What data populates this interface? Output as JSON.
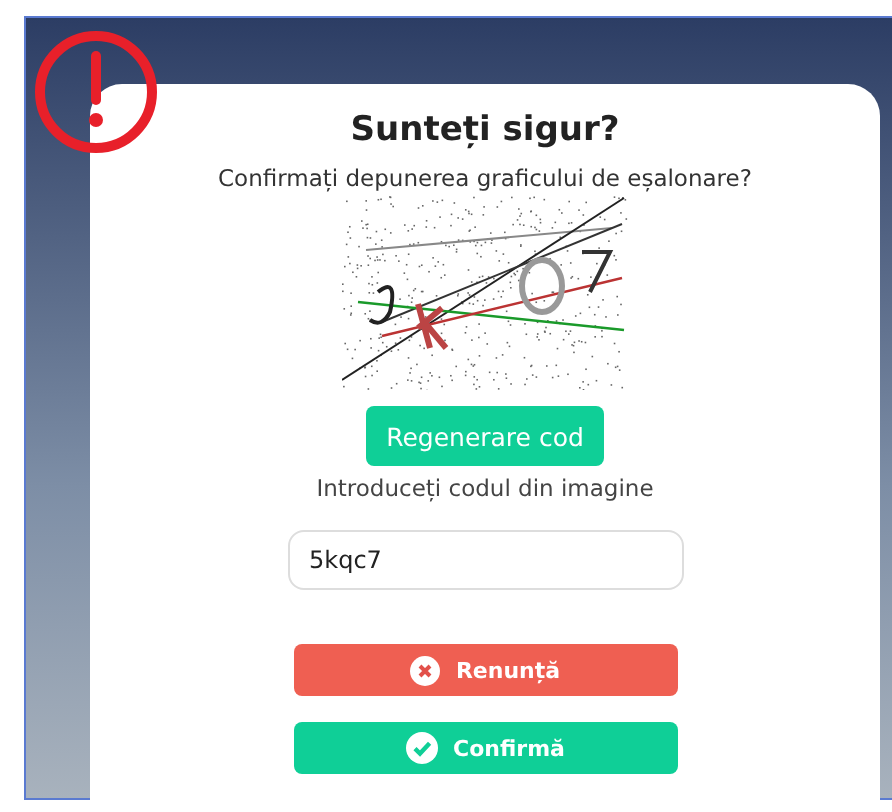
{
  "dialog": {
    "title": "Sunteți sigur?",
    "message": "Confirmați depunerea graficului de eșalonare?",
    "regenerate_button": "Regenerare cod",
    "code_label": "Introduceți codul din imagine",
    "code_value": "5kqc7",
    "buttons": [
      {
        "kind": "cancel",
        "label": "Renunță"
      },
      {
        "kind": "confirm",
        "label": "Confirmă"
      }
    ]
  }
}
